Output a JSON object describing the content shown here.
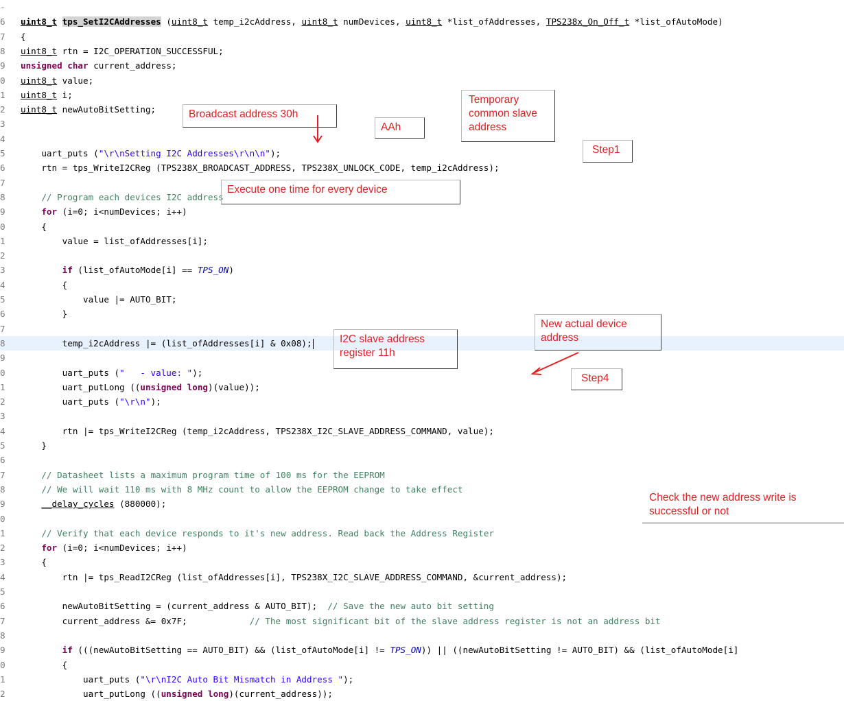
{
  "code_lines": [
    {
      "num": "-",
      "html": ""
    },
    {
      "num": "6",
      "html": "<span class=\"bold ul\">uint8_t</span> <span class=\"fnb\">tps_SetI2CAddresses</span> (<span class=\"ul\">uint8_t</span> temp_i2cAddress, <span class=\"ul\">uint8_t</span> numDevices, <span class=\"ul\">uint8_t</span> *list_ofAddresses, <span class=\"ul\">TPS238x_On_Off_t</span> *list_ofAutoMode)"
    },
    {
      "num": "7",
      "html": "{"
    },
    {
      "num": "8",
      "html": "<span class=\"ul\">uint8_t</span> rtn = I2C_OPERATION_SUCCESSFUL;"
    },
    {
      "num": "9",
      "html": "<span class=\"kw\">unsigned</span> <span class=\"kw\">char</span> current_address;"
    },
    {
      "num": "0",
      "html": "<span class=\"ul\">uint8_t</span> value;"
    },
    {
      "num": "1",
      "html": "<span class=\"ul\">uint8_t</span> i;"
    },
    {
      "num": "2",
      "html": "<span class=\"ul\">uint8_t</span> newAutoBitSetting;"
    },
    {
      "num": "3",
      "html": ""
    },
    {
      "num": "4",
      "html": ""
    },
    {
      "num": "5",
      "html": "    uart_puts (<span class=\"str\">\"\\r\\nSetting I2C Addresses\\r\\n\\n\"</span>);"
    },
    {
      "num": "6",
      "html": "    rtn = tps_WriteI2CReg (TPS238X_BROADCAST_ADDRESS, TPS238X_UNLOCK_CODE, temp_i2cAddress);"
    },
    {
      "num": "7",
      "html": ""
    },
    {
      "num": "8",
      "html": "    <span class=\"cm\">// Program each devices I2C address</span>"
    },
    {
      "num": "9",
      "html": "    <span class=\"kw\">for</span> (i=0; i&lt;numDevices; i++)"
    },
    {
      "num": "0",
      "html": "    {"
    },
    {
      "num": "1",
      "html": "        value = list_ofAddresses[i];"
    },
    {
      "num": "2",
      "html": ""
    },
    {
      "num": "3",
      "html": "        <span class=\"kw\">if</span> (list_ofAutoMode[i] == <span class=\"en\">TPS_ON</span>)"
    },
    {
      "num": "4",
      "html": "        {"
    },
    {
      "num": "5",
      "html": "            value |= AUTO_BIT;"
    },
    {
      "num": "6",
      "html": "        }"
    },
    {
      "num": "7",
      "html": ""
    },
    {
      "num": "8",
      "html": "        temp_i2cAddress |= (list_ofAddresses[i] &amp; 0x08);<span class=\"cursor\"></span>"
    },
    {
      "num": "9",
      "html": ""
    },
    {
      "num": "0",
      "html": "        uart_puts (<span class=\"str\">\"   - value: \"</span>);"
    },
    {
      "num": "1",
      "html": "        uart_putLong ((<span class=\"kw\">unsigned</span> <span class=\"kw\">long</span>)(value));"
    },
    {
      "num": "2",
      "html": "        uart_puts (<span class=\"str\">\"\\r\\n\"</span>);"
    },
    {
      "num": "3",
      "html": ""
    },
    {
      "num": "4",
      "html": "        rtn |= tps_WriteI2CReg (temp_i2cAddress, TPS238X_I2C_SLAVE_ADDRESS_COMMAND, value);"
    },
    {
      "num": "5",
      "html": "    }"
    },
    {
      "num": "6",
      "html": ""
    },
    {
      "num": "7",
      "html": "    <span class=\"cm\">// Datasheet lists a maximum program time of 100 ms for the EEPROM</span>"
    },
    {
      "num": "8",
      "html": "    <span class=\"cm\">// We will wait 110 ms with 8 MHz count to allow the EEPROM change to take effect</span>"
    },
    {
      "num": "9",
      "html": "    <span class=\"ul\">__delay_cycles</span> (880000);"
    },
    {
      "num": "0",
      "html": ""
    },
    {
      "num": "1",
      "html": "    <span class=\"cm\">// Verify that each device responds to it's new address. Read back the Address Register</span>"
    },
    {
      "num": "2",
      "html": "    <span class=\"kw\">for</span> (i=0; i&lt;numDevices; i++)"
    },
    {
      "num": "3",
      "html": "    {"
    },
    {
      "num": "4",
      "html": "        rtn |= tps_ReadI2CReg (list_ofAddresses[i], TPS238X_I2C_SLAVE_ADDRESS_COMMAND, &amp;current_address);"
    },
    {
      "num": "5",
      "html": ""
    },
    {
      "num": "6",
      "html": "        newAutoBitSetting = (current_address &amp; AUTO_BIT);  <span class=\"cm\">// Save the new auto bit setting</span>"
    },
    {
      "num": "7",
      "html": "        current_address &amp;= 0x7F;            <span class=\"cm\">// The most significant bit of the slave address register is not an address bit</span>"
    },
    {
      "num": "8",
      "html": ""
    },
    {
      "num": "9",
      "html": "        <span class=\"kw\">if</span> (((newAutoBitSetting == AUTO_BIT) &amp;&amp; (list_ofAutoMode[i] != <span class=\"en\">TPS_ON</span>)) || ((newAutoBitSetting != AUTO_BIT) &amp;&amp; (list_ofAutoMode[i]"
    },
    {
      "num": "0",
      "html": "        {"
    },
    {
      "num": "1",
      "html": "            uart_puts (<span class=\"str\">\"\\r\\nI2C Auto Bit Mismatch in Address \"</span>);"
    },
    {
      "num": "2",
      "html": "            uart_putLong ((<span class=\"kw\">unsigned</span> <span class=\"kw\">long</span>)(current_address));"
    }
  ],
  "highlighted_line_index": 23,
  "callouts": {
    "broadcast": "Broadcast address 30h",
    "aah": "AAh",
    "temporary": "Temporary\ncommon slave\naddress",
    "step1": "Step1",
    "execute": "Execute one time for every device",
    "new_actual": "New actual device\naddress",
    "i2c_slave": "I2C slave address\nregister 11h",
    "step4": "Step4",
    "check": "Check the new address write is\nsuccessful or not"
  },
  "colors": {
    "annotation_text": "#e02020",
    "keyword": "#7f0055",
    "string": "#2a00ff",
    "comment": "#3f7f5f",
    "highlight": "#e8f2fe"
  }
}
